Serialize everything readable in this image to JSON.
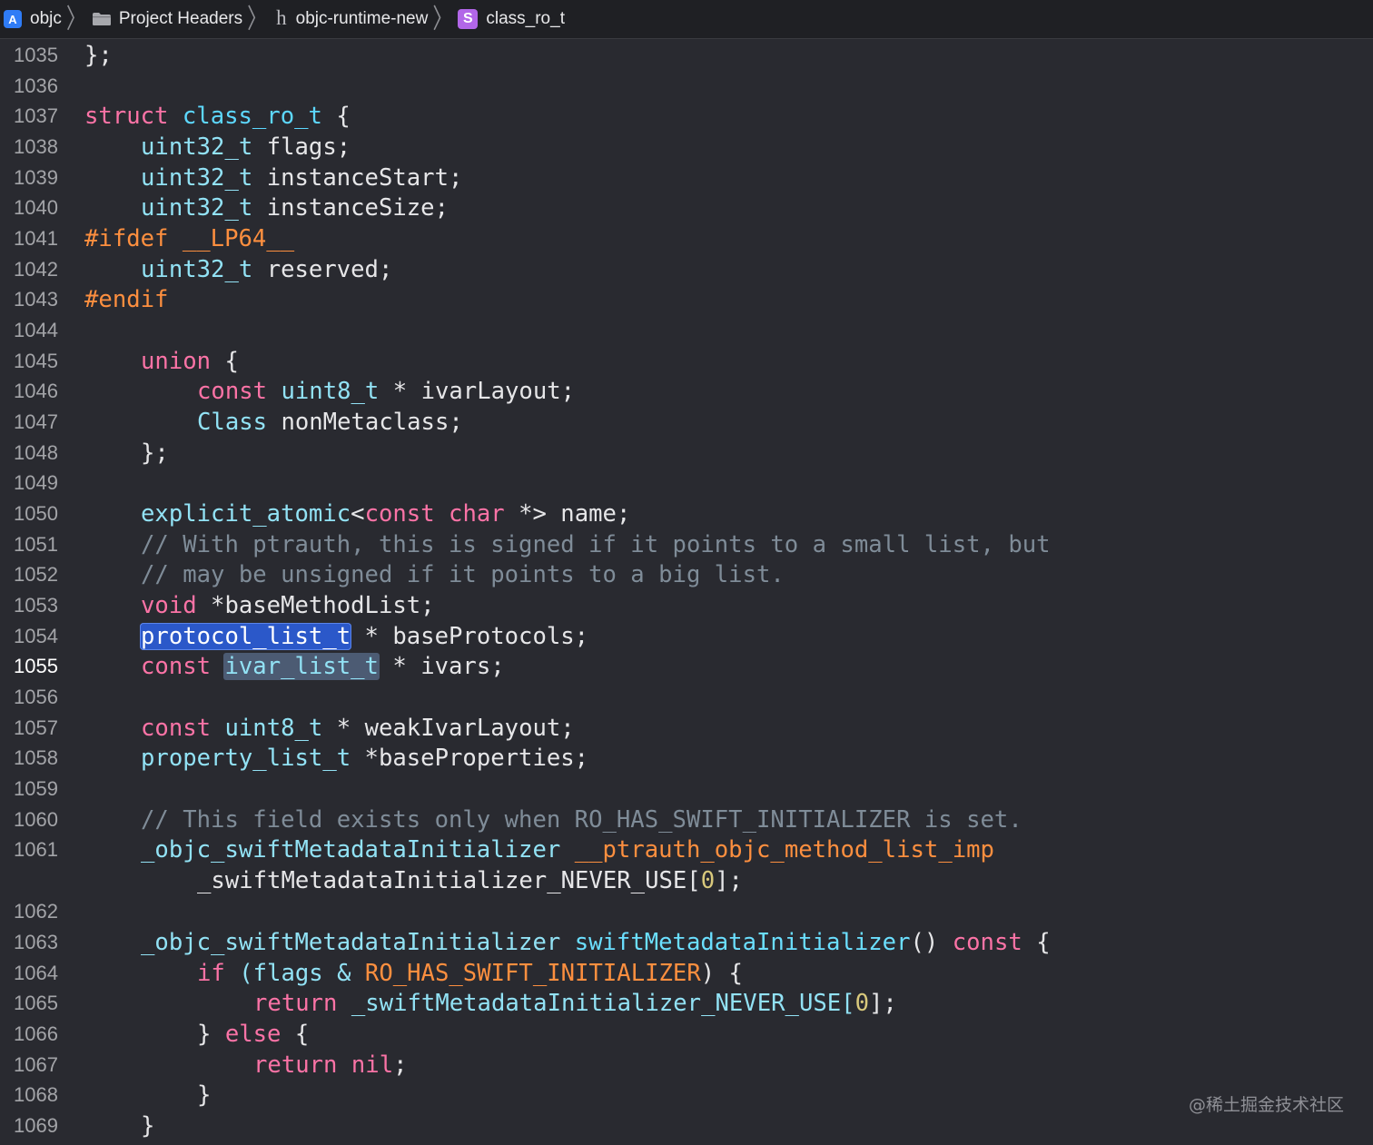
{
  "breadcrumb": {
    "items": [
      {
        "label": "objc",
        "icon": "xcode-project-icon"
      },
      {
        "label": "Project Headers",
        "icon": "folder-icon"
      },
      {
        "label": "objc-runtime-new",
        "icon": "header-file-icon"
      },
      {
        "label": "class_ro_t",
        "icon": "struct-symbol-icon"
      }
    ],
    "separator": "〉",
    "icon_glyphs": {
      "xcode": "A",
      "header": "h",
      "struct": "S"
    }
  },
  "editor": {
    "current_line": "1055",
    "line_numbers": [
      "1035",
      "1036",
      "1037",
      "1038",
      "1039",
      "1040",
      "1041",
      "1042",
      "1043",
      "1044",
      "1045",
      "1046",
      "1047",
      "1048",
      "1049",
      "1050",
      "1051",
      "1052",
      "1053",
      "1054",
      "1055",
      "1056",
      "1057",
      "1058",
      "1059",
      "1060",
      "1061",
      "",
      "1062",
      "1063",
      "1064",
      "1065",
      "1066",
      "1067",
      "1068",
      "1069"
    ],
    "code": {
      "l1035": {
        "t0": "};"
      },
      "l1037": {
        "t0": "struct",
        "t1": " ",
        "t2": "class_ro_t",
        "t3": " {"
      },
      "l1038": {
        "t0": "uint32_t",
        "t1": " flags;"
      },
      "l1039": {
        "t0": "uint32_t",
        "t1": " instanceStart;"
      },
      "l1040": {
        "t0": "uint32_t",
        "t1": " instanceSize;"
      },
      "l1041": {
        "t0": "#ifdef __LP64__"
      },
      "l1042": {
        "t0": "uint32_t",
        "t1": " reserved;"
      },
      "l1043": {
        "t0": "#endif"
      },
      "l1045": {
        "t0": "union",
        "t1": " {"
      },
      "l1046": {
        "t0": "const",
        "t1": " ",
        "t2": "uint8_t",
        "t3": " * ivarLayout;"
      },
      "l1047": {
        "t0": "Class",
        "t1": " nonMetaclass;"
      },
      "l1048": {
        "t0": "};"
      },
      "l1050": {
        "t0": "explicit_atomic",
        "t1": "<",
        "t2": "const",
        "t3": " ",
        "t4": "char",
        "t5": " *> name;"
      },
      "l1051": {
        "t0": "// With ptrauth, this is signed if it points to a small list, but"
      },
      "l1052": {
        "t0": "// may be unsigned if it points to a big list."
      },
      "l1053": {
        "t0": "void",
        "t1": " *baseMethodList;"
      },
      "l1054": {
        "t0": "protocol_list_t",
        "t1": " * baseProtocols;"
      },
      "l1055": {
        "t0": "const",
        "t1": " ",
        "t2": "ivar_list_t",
        "t3": " * ivars;"
      },
      "l1057": {
        "t0": "const",
        "t1": " ",
        "t2": "uint8_t",
        "t3": " * weakIvarLayout;"
      },
      "l1058": {
        "t0": "property_list_t",
        "t1": " *baseProperties;"
      },
      "l1060": {
        "t0": "// This field exists only when RO_HAS_SWIFT_INITIALIZER is set."
      },
      "l1061": {
        "t0": "_objc_swiftMetadataInitializer",
        "t1": " ",
        "t2": "__ptrauth_objc_method_list_imp"
      },
      "l1061b": {
        "t0": "_swiftMetadataInitializer_NEVER_USE[",
        "t1": "0",
        "t2": "];"
      },
      "l1063": {
        "t0": "_objc_swiftMetadataInitializer",
        "t1": " ",
        "t2": "swiftMetadataInitializer",
        "t3": "() ",
        "t4": "const",
        "t5": " {"
      },
      "l1064": {
        "t0": "if",
        "t1": " (flags & ",
        "t2": "RO_HAS_SWIFT_INITIALIZER",
        "t3": ") {"
      },
      "l1065": {
        "t0": "return",
        "t1": " _swiftMetadataInitializer_NEVER_USE[",
        "t2": "0",
        "t3": "];"
      },
      "l1066": {
        "t0": "} ",
        "t1": "else",
        "t2": " {"
      },
      "l1067": {
        "t0": "return",
        "t1": " ",
        "t2": "nil",
        "t3": ";"
      },
      "l1068": {
        "t0": "}"
      },
      "l1069": {
        "t0": "}"
      }
    }
  },
  "watermark": "@稀土掘金技术社区",
  "colors": {
    "background": "#292a30",
    "keyword": "#fb73a6",
    "type": "#92e2f5",
    "comment": "#7f8c98",
    "preprocessor": "#fd8f3f",
    "number": "#d9c97c",
    "selection": "#2b58c9"
  }
}
